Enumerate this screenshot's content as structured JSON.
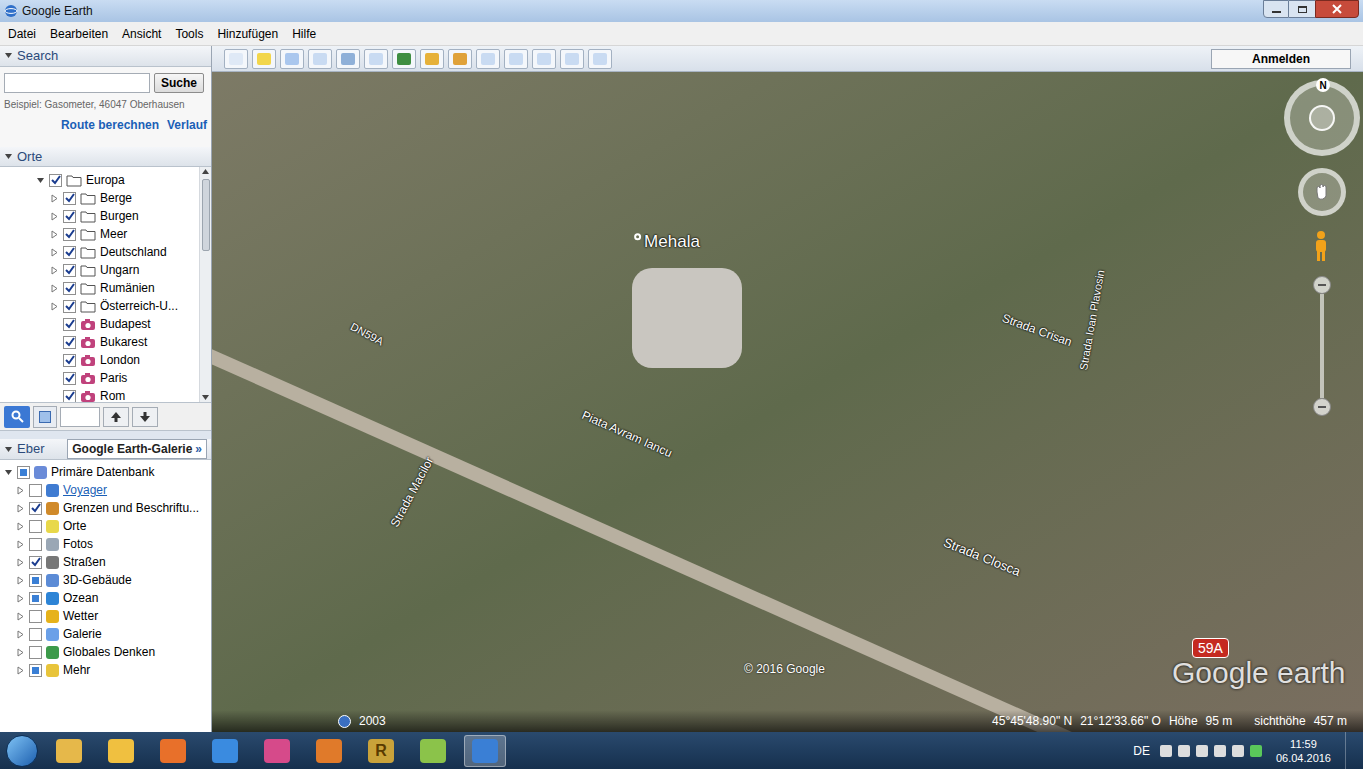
{
  "window": {
    "title": "Google Earth"
  },
  "menu": [
    "Datei",
    "Bearbeiten",
    "Ansicht",
    "Tools",
    "Hinzufügen",
    "Hilfe"
  ],
  "toolbar": {
    "signin": "Anmelden"
  },
  "search": {
    "header": "Search",
    "expanded": true,
    "placeholder": "",
    "button": "Suche",
    "example": "Beispiel: Gasometer, 46047 Oberhausen",
    "links": [
      "Route berechnen",
      "Verlauf"
    ]
  },
  "places": {
    "header": "Orte",
    "expanded": true,
    "items": [
      {
        "label": "Europa",
        "kind": "folder",
        "depth": 0,
        "checked": true,
        "expanded": true
      },
      {
        "label": "Berge",
        "kind": "folder",
        "depth": 1,
        "checked": true,
        "expanded": false
      },
      {
        "label": "Burgen",
        "kind": "folder",
        "depth": 1,
        "checked": true,
        "expanded": false
      },
      {
        "label": "Meer",
        "kind": "folder",
        "depth": 1,
        "checked": true,
        "expanded": false
      },
      {
        "label": "Deutschland",
        "kind": "folder",
        "depth": 1,
        "checked": true,
        "expanded": false
      },
      {
        "label": "Ungarn",
        "kind": "folder",
        "depth": 1,
        "checked": true,
        "expanded": false
      },
      {
        "label": "Rumänien",
        "kind": "folder",
        "depth": 1,
        "checked": true,
        "expanded": false
      },
      {
        "label": "Österreich-U...",
        "kind": "folder",
        "depth": 1,
        "checked": true,
        "expanded": false
      },
      {
        "label": "Budapest",
        "kind": "photo",
        "depth": 1,
        "checked": true,
        "expanded": false
      },
      {
        "label": "Bukarest",
        "kind": "photo",
        "depth": 1,
        "checked": true,
        "expanded": false
      },
      {
        "label": "London",
        "kind": "photo",
        "depth": 1,
        "checked": true,
        "expanded": false
      },
      {
        "label": "Paris",
        "kind": "photo",
        "depth": 1,
        "checked": true,
        "expanded": false
      },
      {
        "label": "Rom",
        "kind": "photo",
        "depth": 1,
        "checked": true,
        "expanded": false
      }
    ]
  },
  "layers": {
    "header": "Eber",
    "expanded": true,
    "gallery": "Google Earth-Galerie",
    "gallery_icon": "»",
    "items": [
      {
        "label": "Primäre Datenbank",
        "kind": "item",
        "depth": 0,
        "checked": false,
        "partial": true,
        "expanded": true
      },
      {
        "label": "Voyager",
        "kind": "link",
        "depth": 1,
        "checked": false,
        "partial": false,
        "expanded": false
      },
      {
        "label": "Grenzen und Beschriftu...",
        "kind": "item",
        "depth": 1,
        "checked": true,
        "partial": false,
        "expanded": false
      },
      {
        "label": "Orte",
        "kind": "item",
        "depth": 1,
        "checked": false,
        "partial": false,
        "expanded": false
      },
      {
        "label": "Fotos",
        "kind": "item",
        "depth": 1,
        "checked": false,
        "partial": false,
        "expanded": false
      },
      {
        "label": "Straßen",
        "kind": "item",
        "depth": 1,
        "checked": true,
        "partial": false,
        "expanded": false
      },
      {
        "label": "3D-Gebäude",
        "kind": "item",
        "depth": 1,
        "checked": false,
        "partial": true,
        "expanded": false
      },
      {
        "label": "Ozean",
        "kind": "item",
        "depth": 1,
        "checked": false,
        "partial": true,
        "expanded": false
      },
      {
        "label": "Wetter",
        "kind": "item",
        "depth": 1,
        "checked": false,
        "partial": false,
        "expanded": false
      },
      {
        "label": "Galerie",
        "kind": "item",
        "depth": 1,
        "checked": false,
        "partial": false,
        "expanded": false
      },
      {
        "label": "Globales Denken",
        "kind": "item",
        "depth": 1,
        "checked": false,
        "partial": false,
        "expanded": false
      },
      {
        "label": "Mehr",
        "kind": "item",
        "depth": 1,
        "checked": false,
        "partial": true,
        "expanded": false
      }
    ]
  },
  "map": {
    "labels": [
      "Mehala",
      "DN59A",
      "Piata Avram Iancu",
      "Strada Crisan",
      "Strada Ioan Plavosin",
      "Strada Macilor",
      "Strada Closca"
    ],
    "compass": "N",
    "shield": "59A",
    "copyright": "© 2016 Google",
    "logo": "Google earth",
    "date": "2003",
    "status": {
      "lat": "45°45'48.90\" N",
      "lon": "21°12'33.66\" O",
      "elevation_label": "Höhe",
      "elevation": "95 m",
      "eye_label": "sichthöhe",
      "eye": "457 m"
    }
  },
  "taskbar": {
    "app_badge": "R",
    "language": "DE",
    "time": "11:59",
    "date": "06.04.2016"
  }
}
